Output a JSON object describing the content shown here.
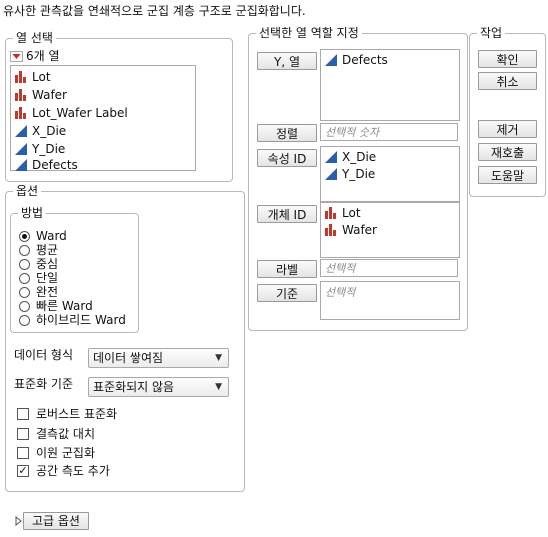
{
  "instruction": "유사한 관측값을 연쇄적으로 군집 계층 구조로 군집화합니다.",
  "column_selection": {
    "title": "열 선택",
    "count_label": "6개 열",
    "columns": [
      {
        "name": "Lot",
        "icon": "nominal-bar-icon"
      },
      {
        "name": "Wafer",
        "icon": "nominal-bar-icon"
      },
      {
        "name": "Lot_Wafer Label",
        "icon": "nominal-bar-icon"
      },
      {
        "name": "X_Die",
        "icon": "continuous-triangle-icon"
      },
      {
        "name": "Y_Die",
        "icon": "continuous-triangle-icon"
      },
      {
        "name": "Defects",
        "icon": "continuous-triangle-icon"
      }
    ]
  },
  "roles": {
    "title": "선택한 열 역할 지정",
    "y_button": "Y, 열",
    "y_items": [
      "Defects"
    ],
    "order_button": "정렬",
    "order_placeholder": "선택적 숫자",
    "attr_button": "속성 ID",
    "attr_items": [
      "X_Die",
      "Y_Die"
    ],
    "object_button": "개체 ID",
    "object_items": [
      "Lot",
      "Wafer"
    ],
    "label_button": "라벨",
    "label_placeholder": "선택적",
    "by_button": "기준",
    "by_placeholder": "선택적"
  },
  "actions": {
    "title": "작업",
    "ok": "확인",
    "cancel": "취소",
    "remove": "제거",
    "recall": "재호출",
    "help": "도움말"
  },
  "options": {
    "title": "옵션",
    "method_title": "방법",
    "methods": [
      "Ward",
      "평균",
      "중심",
      "단일",
      "완전",
      "빠른 Ward",
      "하이브리드 Ward"
    ],
    "selected_method": "Ward",
    "data_format_label": "데이터 형식",
    "data_format_value": "데이터 쌓여짐",
    "standardize_label": "표준화 기준",
    "standardize_value": "표준화되지 않음",
    "checks": [
      {
        "label": "로버스트 표준화",
        "checked": false
      },
      {
        "label": "결측값 대치",
        "checked": false
      },
      {
        "label": "이원 군집화",
        "checked": false
      },
      {
        "label": "공간 측도 추가",
        "checked": true
      }
    ]
  },
  "advanced_button": "고급 옵션",
  "colors": {
    "nominal": "#c0392b",
    "continuous": "#2a5db0",
    "menu_triangle": "#d0262b"
  }
}
